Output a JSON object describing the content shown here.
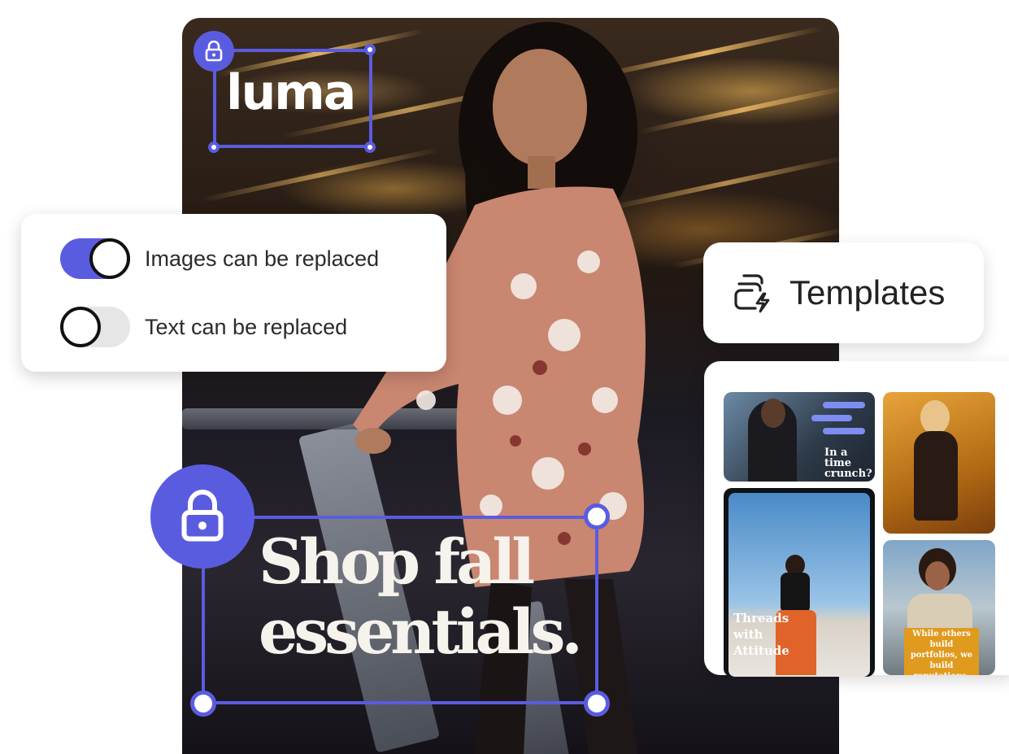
{
  "brand": {
    "logo_text": "luma",
    "accent_color": "#5a5ce0"
  },
  "poster": {
    "headline_line1": "Shop fall",
    "headline_line2": "essentials."
  },
  "settings": {
    "images_toggle": {
      "label": "Images can be replaced",
      "state": "on"
    },
    "text_toggle": {
      "label": "Text can be replaced",
      "state": "off"
    }
  },
  "templates": {
    "title": "Templates",
    "icon": "templates-icon",
    "cards": [
      {
        "caption": "In a time crunch?"
      },
      {
        "caption": ""
      },
      {
        "caption": "Threads with Attitude"
      },
      {
        "caption": "While others build portfolios, we build reputations."
      }
    ]
  }
}
